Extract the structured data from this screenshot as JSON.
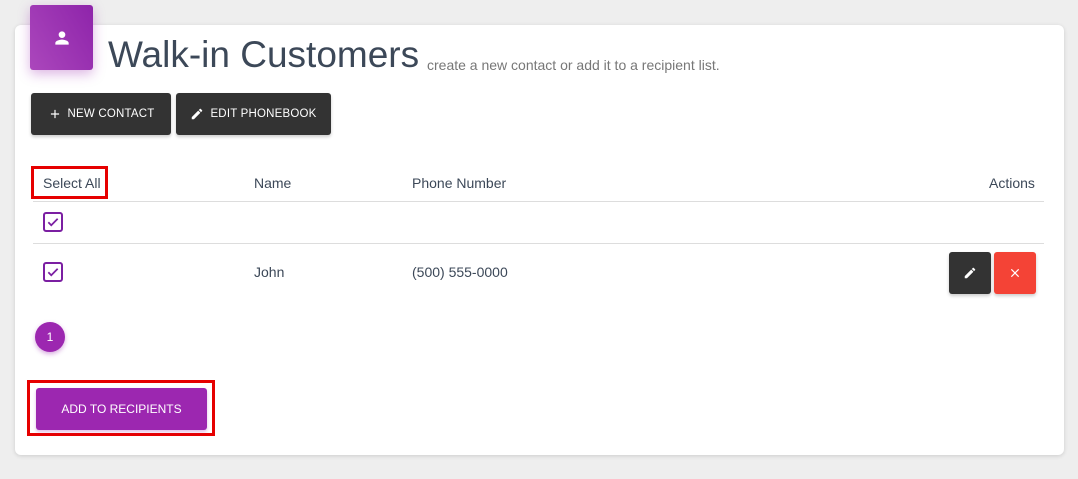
{
  "header": {
    "icon": "person-icon",
    "title": "Walk-in Customers",
    "subtitle": "create a new contact or add it to a recipient list."
  },
  "toolbar": {
    "new_contact_label": "NEW CONTACT",
    "new_contact_icon": "plus-icon",
    "edit_phonebook_label": "EDIT PHONEBOOK",
    "edit_phonebook_icon": "pencil-icon"
  },
  "table": {
    "columns": [
      "Select All",
      "Name",
      "Phone Number",
      "Actions"
    ],
    "select_all_checked": true,
    "rows": [
      {
        "checked": true,
        "name": "John",
        "phone": "(500) 555-0000"
      }
    ]
  },
  "pagination": {
    "current_page": "1"
  },
  "footer": {
    "add_to_recipients_label": "ADD TO RECIPIENTS"
  },
  "colors": {
    "accent": "#9c27b0",
    "dark_button": "#333333",
    "danger": "#f44336",
    "highlight": "#e60000"
  }
}
